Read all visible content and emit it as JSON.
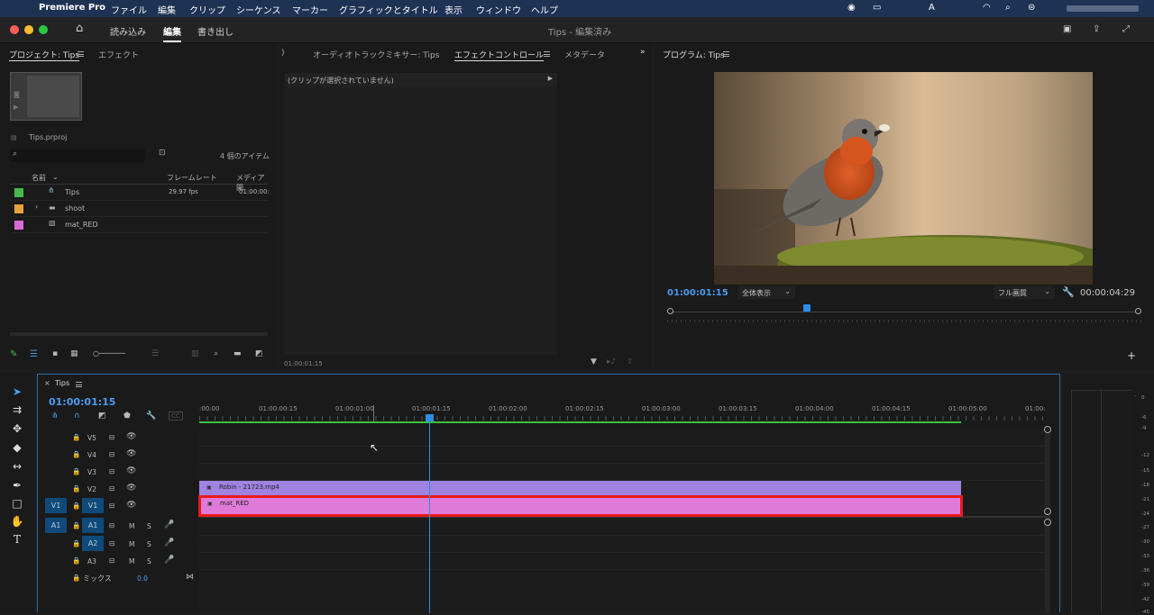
{
  "menubar": {
    "app": "Premiere Pro",
    "items": [
      "ファイル",
      "編集",
      "クリップ",
      "シーケンス",
      "マーカー",
      "グラフィックとタイトル",
      "表示",
      "ウィンドウ",
      "ヘルプ"
    ]
  },
  "workspace": {
    "tabs": [
      "読み込み",
      "編集",
      "書き出し"
    ],
    "active": "編集",
    "title": "Tips - 編集済み"
  },
  "project": {
    "tab_label": "プロジェクト: Tips",
    "effects_tab": "エフェクト",
    "proj_file": "Tips.prproj",
    "item_count": "4 個のアイテム",
    "col_name": "名前",
    "col_fps": "フレームレート",
    "col_media": "メディア開",
    "items": [
      {
        "name": "Tips",
        "fps": "29.97 fps",
        "media": "01:00:00:",
        "color": "#46b94c"
      },
      {
        "name": "shoot",
        "fps": "",
        "media": "",
        "color": "#e8a23a"
      },
      {
        "name": "mat_RED",
        "fps": "",
        "media": "",
        "color": "#d96ad4"
      }
    ]
  },
  "effects": {
    "prev_tab": ")",
    "mixer_tab": "オーディオトラックミキサー: Tips",
    "control_tab": "エフェクトコントロール",
    "meta_tab": "メタデータ",
    "no_clip": "(クリップが選択されていません)",
    "timecode": "01:00:01:15"
  },
  "program": {
    "tab": "プログラム: Tips",
    "timecode": "01:00:01:15",
    "fit": "全体表示",
    "quality": "フル画質",
    "duration": "00:00:04:29"
  },
  "timeline": {
    "tab": "Tips",
    "timecode": "01:00:01:15",
    "ruler": [
      ":00:00",
      "01:00:00:15",
      "01:00:01:00",
      "01:00:01:15",
      "01:00:02:00",
      "01:00:02:15",
      "01:00:03:00",
      "01:00:03:15",
      "01:00:04:00",
      "01:00:04:15",
      "01:00:05:00",
      "01:00:"
    ],
    "video_tracks": [
      "V5",
      "V4",
      "V3",
      "V2",
      "V1"
    ],
    "audio_tracks": [
      "A1",
      "A2",
      "A3"
    ],
    "src_v": "V1",
    "src_a": "A1",
    "m": "M",
    "s": "S",
    "mix": "ミックス",
    "mix_val": "0.0",
    "clip1": "Robin - 21723.mp4",
    "clip2": "mat_RED"
  },
  "meter": {
    "ticks": [
      "0",
      "-6",
      "-9",
      "-12",
      "-15",
      "-18",
      "-21",
      "-24",
      "-27",
      "-30",
      "-33",
      "-36",
      "-39",
      "-42",
      "-45"
    ]
  }
}
